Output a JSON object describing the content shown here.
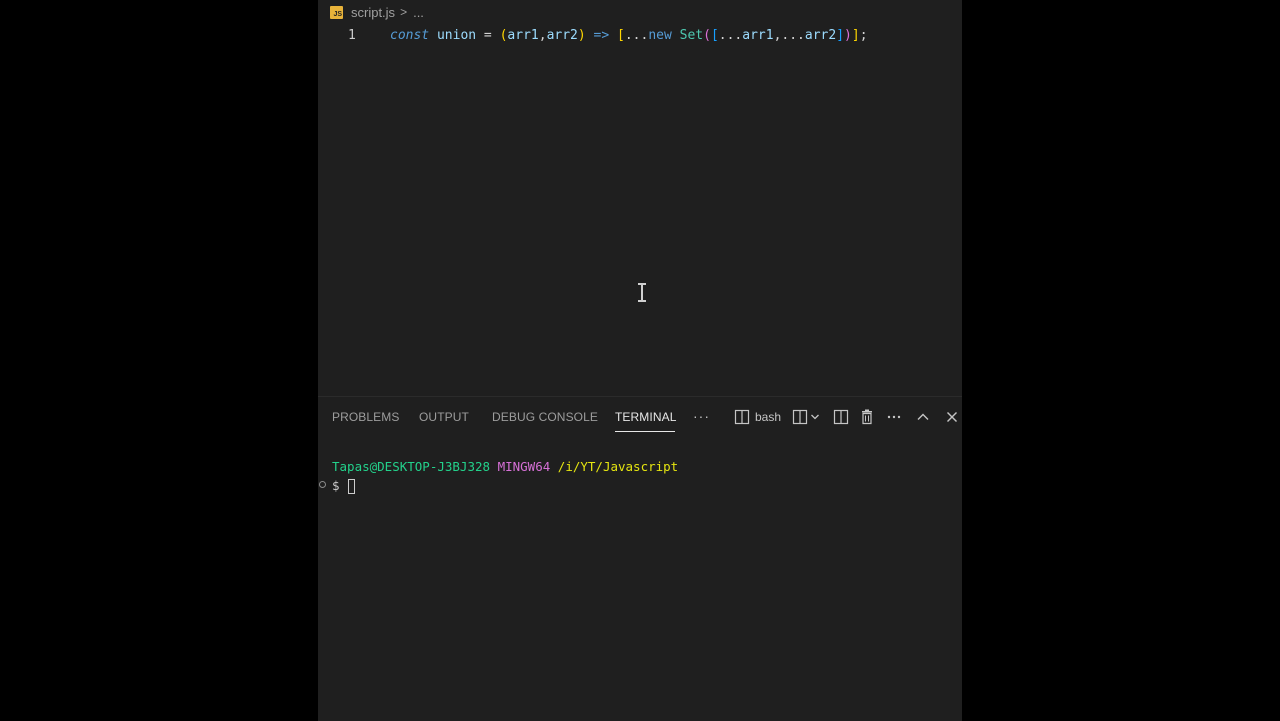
{
  "editor": {
    "breadcrumb": {
      "file_icon_text": "JS",
      "filename": "script.js",
      "separator": ">",
      "more": "..."
    },
    "lines": [
      {
        "number": "1",
        "tokens": [
          {
            "t": "const",
            "c": "kw"
          },
          {
            "t": " ",
            "c": "op"
          },
          {
            "t": "union",
            "c": "var"
          },
          {
            "t": " = ",
            "c": "op"
          },
          {
            "t": "(",
            "c": "p1"
          },
          {
            "t": "arr1",
            "c": "var"
          },
          {
            "t": ",",
            "c": "op"
          },
          {
            "t": "arr2",
            "c": "var"
          },
          {
            "t": ")",
            "c": "p1"
          },
          {
            "t": " => ",
            "c": "kw2"
          },
          {
            "t": "[",
            "c": "p1"
          },
          {
            "t": "...",
            "c": "op"
          },
          {
            "t": "new",
            "c": "kw2"
          },
          {
            "t": " ",
            "c": "op"
          },
          {
            "t": "Set",
            "c": "cls"
          },
          {
            "t": "(",
            "c": "p2"
          },
          {
            "t": "[",
            "c": "p3"
          },
          {
            "t": "...",
            "c": "op"
          },
          {
            "t": "arr1",
            "c": "var"
          },
          {
            "t": ",",
            "c": "op"
          },
          {
            "t": "...",
            "c": "op"
          },
          {
            "t": "arr2",
            "c": "var"
          },
          {
            "t": "]",
            "c": "p3"
          },
          {
            "t": ")",
            "c": "p2"
          },
          {
            "t": "]",
            "c": "p1"
          },
          {
            "t": ";",
            "c": "op"
          }
        ]
      }
    ]
  },
  "panel": {
    "tabs": [
      {
        "label": "PROBLEMS",
        "active": false
      },
      {
        "label": "OUTPUT",
        "active": false
      },
      {
        "label": "DEBUG CONSOLE",
        "active": false
      },
      {
        "label": "TERMINAL",
        "active": true
      }
    ],
    "more_icon": "···",
    "shell_label": "bash",
    "icons": {
      "terminal": "terminal-icon",
      "split_dropdown": "split-dropdown-icon",
      "split": "split-terminal-icon",
      "trash": "trash-icon",
      "ellipsis": "more-actions-icon",
      "maximize": "chevron-up-icon",
      "close": "close-icon"
    }
  },
  "terminal": {
    "user_host": "Tapas@DESKTOP-J3BJ328",
    "system": "MINGW64",
    "path": "/i/YT/Javascript",
    "prompt_symbol": "$"
  },
  "colors": {
    "background": "#1f1f1f",
    "user_host": "#23d18b",
    "system": "#d670d6",
    "path": "#e5e510"
  }
}
